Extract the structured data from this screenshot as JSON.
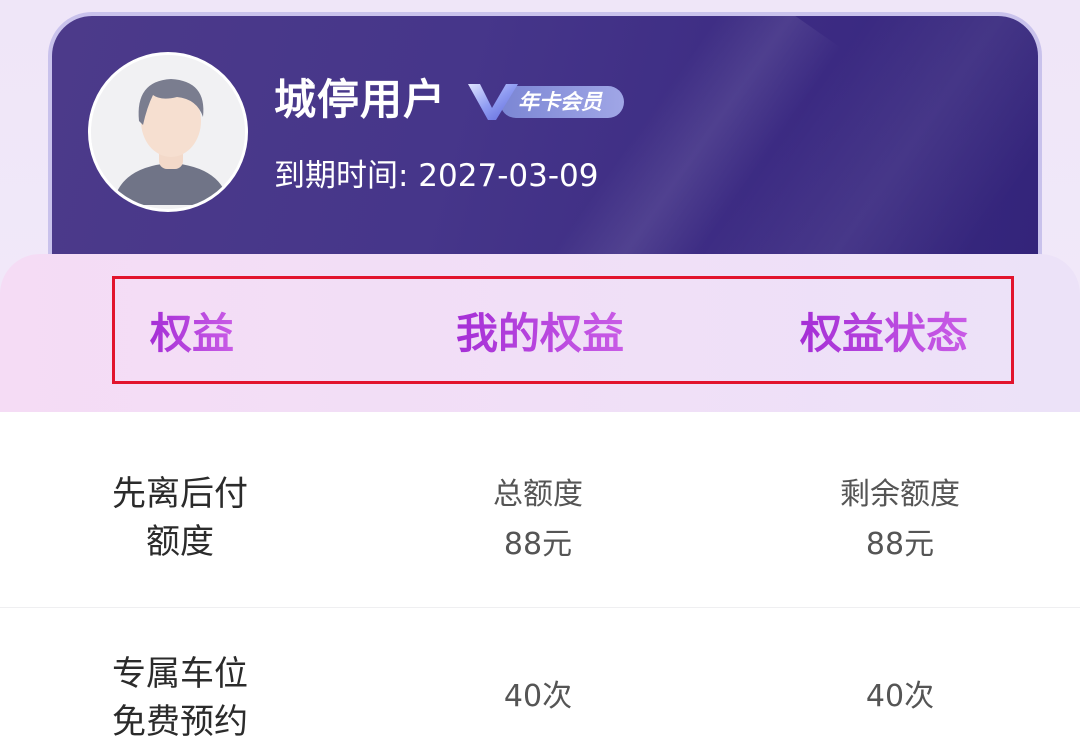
{
  "profile": {
    "username": "城停用户",
    "badge_text": "年卡会员",
    "expiry_label": "到期时间: 2027-03-09"
  },
  "tabs": [
    {
      "label": "权益"
    },
    {
      "label": "我的权益"
    },
    {
      "label": "权益状态"
    }
  ],
  "rows": [
    {
      "name_line1": "先离后付",
      "name_line2": "额度",
      "col2_title": "总额度",
      "col2_value": "88元",
      "col3_title": "剩余额度",
      "col3_value": "88元"
    },
    {
      "name_line1": "专属车位",
      "name_line2": "免费预约",
      "col2_value": "40次",
      "col3_value": "40次"
    }
  ],
  "colors": {
    "card_bg": "#46368a",
    "tab_text": "#b443df",
    "highlight_box": "#e2142d"
  }
}
